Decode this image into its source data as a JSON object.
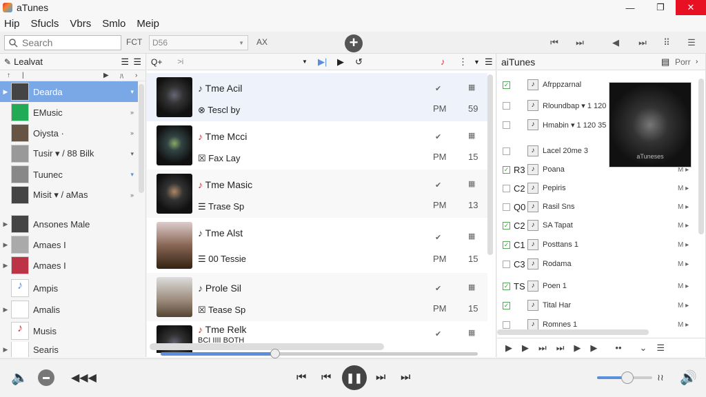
{
  "window": {
    "title": "aTunes",
    "min": "—",
    "max": "❐",
    "close": "✕"
  },
  "menu": [
    "Hip",
    "Sfucls",
    "Vbrs",
    "Smlo",
    "Meip"
  ],
  "toolbar": {
    "search_placeholder": "Search",
    "label1": "FCT",
    "select_value": "D56",
    "label2": "AX",
    "add": "+"
  },
  "library": {
    "header": "Lealvat",
    "items": [
      {
        "label": "Dearda",
        "ext": "▾"
      },
      {
        "label": "EMusic",
        "ext": "»"
      },
      {
        "label": "Oiysta ·",
        "ext": "»"
      },
      {
        "label": "Tusir ▾ / 88 Bilk",
        "ext": "▾"
      },
      {
        "label": "Tuunec",
        "ext": "▾"
      },
      {
        "label": "Misit ▾ / aMas",
        "ext": "»"
      },
      {
        "label": "Ansones Male",
        "ext": ""
      },
      {
        "label": "Amaes I",
        "ext": ""
      },
      {
        "label": "Amaes I",
        "ext": ""
      },
      {
        "label": "Ampis",
        "ext": ""
      },
      {
        "label": "Amalis",
        "ext": ""
      },
      {
        "label": "Musis",
        "ext": ""
      },
      {
        "label": "Searis",
        "ext": ""
      }
    ]
  },
  "tracks": [
    {
      "title": "Tme Acil",
      "sub": "Tescl by",
      "time": "PM",
      "num": "59"
    },
    {
      "title": "Tme Mcci",
      "sub": "Fax Lay",
      "time": "PM",
      "num": "15"
    },
    {
      "title": "Tme Masic",
      "sub": "Trase Sp",
      "time": "PM",
      "num": "13"
    },
    {
      "title": "Tme Alst",
      "sub": "00 Tessie",
      "time": "PM",
      "num": "15"
    },
    {
      "title": "Prole Sil",
      "sub": "Tease Sp",
      "time": "PM",
      "num": "15"
    },
    {
      "title": "Tme Relk",
      "sub": "BCI IIII BOTH",
      "time": "",
      "num": ""
    }
  ],
  "right_pane": {
    "header": "aiTunes",
    "header_right": "Porr",
    "rows": [
      {
        "code": "",
        "text": "Afrppzarnal",
        "checked": true
      },
      {
        "code": "",
        "text": "Rloundbap ▾ 1 120 35",
        "checked": false
      },
      {
        "code": "",
        "text": "Hmabin ▾ 1 120 35",
        "checked": false
      },
      {
        "code": "",
        "text": "Lacel 20me 3",
        "checked": false
      },
      {
        "code": "R3",
        "text": "Poana",
        "checked": true
      },
      {
        "code": "C2",
        "text": "Pepiris",
        "checked": false
      },
      {
        "code": "Q0",
        "text": "Rasil Sns",
        "checked": false
      },
      {
        "code": "C2",
        "text": "SA Tapat",
        "checked": true
      },
      {
        "code": "C1",
        "text": "Posttans 1",
        "checked": true
      },
      {
        "code": "C3",
        "text": "Rodama",
        "checked": false
      },
      {
        "code": "TS",
        "text": "Poen 1",
        "checked": true
      },
      {
        "code": "",
        "text": "Tital Har",
        "checked": true
      },
      {
        "code": "",
        "text": "Romnes 1",
        "checked": false
      }
    ],
    "art_caption": "aTuneses"
  },
  "player": {
    "progress": 0.36,
    "volume": 0.55
  }
}
